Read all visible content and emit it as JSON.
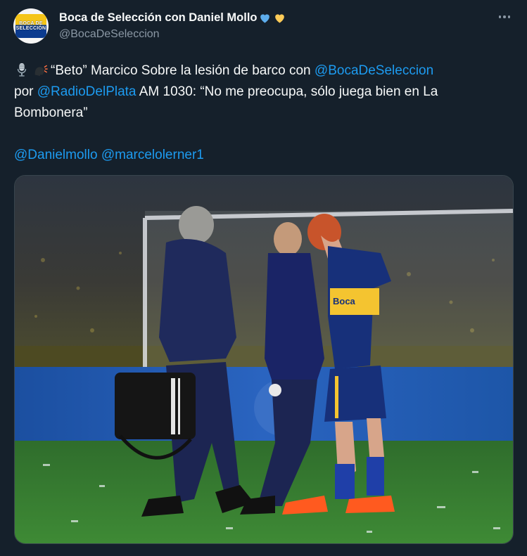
{
  "author": {
    "display_name": "Boca de Selección con Daniel Mollo",
    "handle": "@BocaDeSeleccion",
    "avatar_text": "BOCA DE SELECCIÓN",
    "badge_emojis": [
      "blue-heart-icon",
      "yellow-heart-icon"
    ]
  },
  "tweet": {
    "line1_pre": "“Beto” Marcico Sobre la lesión de barco con ",
    "line1_link": "@BocaDeSeleccion",
    "line2_pre": "por ",
    "line2_link": "@RadioDelPlata",
    "line2_post": " AM 1030: “No me preocupa, sólo juega bien en La",
    "line3": "Bombonera”",
    "mention1": "@Danielmollo",
    "mention2": "@marcelolerner1",
    "leading_emojis": [
      "microphone-icon",
      "speaking-head-icon"
    ]
  },
  "media": {
    "description_icon": "photo-of-injured-player-icon",
    "jersey_text": "Boca"
  },
  "colors": {
    "background": "#15202b",
    "text": "#f7f9f9",
    "secondary": "#8b98a5",
    "link": "#1d9bf0",
    "border": "#38444d"
  }
}
